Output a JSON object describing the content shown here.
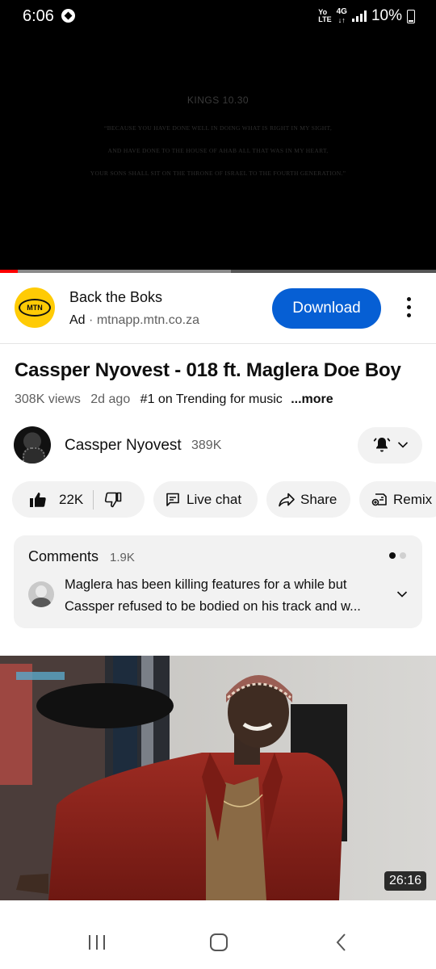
{
  "status_bar": {
    "time": "6:06",
    "network_top": "Yo",
    "network_bottom": "LTE",
    "network_type": "4G",
    "battery": "10%"
  },
  "player": {
    "verse_title": "KINGS 10.30",
    "verse_lines": [
      "“BECAUSE YOU HAVE DONE WELL IN DOING WHAT IS RIGHT IN MY SIGHT,",
      "AND HAVE DONE TO THE HOUSE OF AHAB ALL THAT WAS IN MY HEART,",
      "YOUR SONS SHALL SIT ON THE THRONE OF ISRAEL TO THE FOURTH GENERATION.”"
    ],
    "progress_played": 0.04,
    "progress_buffered": 0.53
  },
  "ad": {
    "logo_text": "MTN",
    "title": "Back the Boks",
    "label": "Ad",
    "separator": "·",
    "domain": "mtnapp.mtn.co.za",
    "cta": "Download",
    "brand_color": "#ffcb05",
    "cta_color": "#065fd4"
  },
  "video": {
    "title": "Cassper Nyovest - 018 ft. Maglera Doe Boy",
    "views": "308K views",
    "age": "2d ago",
    "trending": "#1 on Trending for music",
    "more": "...more"
  },
  "channel": {
    "name": "Cassper Nyovest",
    "subscribers": "389K"
  },
  "actions": {
    "likes": "22K",
    "live_chat": "Live chat",
    "share": "Share",
    "remix": "Remix"
  },
  "comments": {
    "title": "Comments",
    "count": "1.9K",
    "top_comment_lines": [
      "Maglera has been killing features for a while but",
      "Cassper refused to be bodied on his track and w..."
    ]
  },
  "next_video": {
    "duration": "26:16"
  }
}
